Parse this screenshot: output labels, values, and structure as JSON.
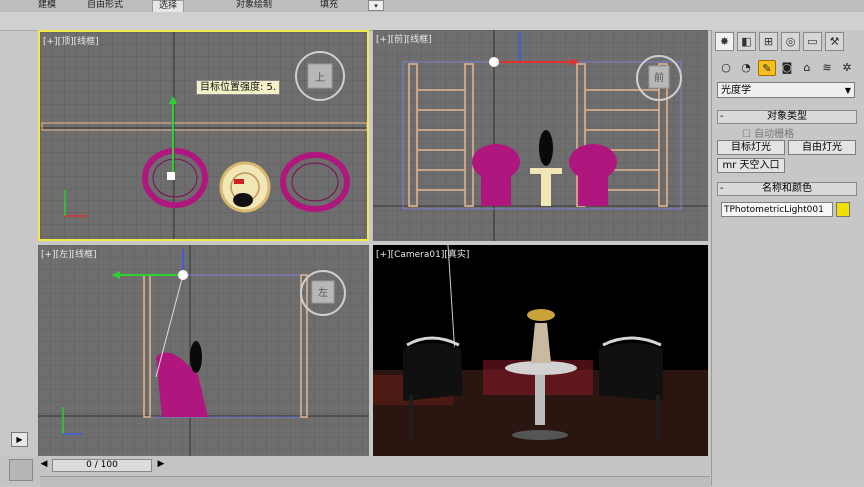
{
  "ribbon": {
    "tabs": [
      "建模",
      "自由形式",
      "选择",
      "对象绘制",
      "填充"
    ],
    "active_tab": "选择"
  },
  "viewports": {
    "top": {
      "label": "[+][顶][线框]",
      "tooltip": "目标位置强度: 5.",
      "view_cube": "上"
    },
    "front": {
      "label": "[+][前][线框]",
      "view_cube": "前"
    },
    "left": {
      "label": "[+][左][线框]",
      "view_cube": "左"
    },
    "camera": {
      "label": "[+][Camera01][真实]"
    }
  },
  "command_panel": {
    "tabs": [
      "create-icon",
      "modify-icon",
      "hierarchy-icon",
      "motion-icon",
      "display-icon",
      "utilities-icon"
    ],
    "subcategories": [
      "geometry-icon",
      "shapes-icon",
      "lights-icon",
      "cameras-icon",
      "helpers-icon",
      "spacewarps-icon",
      "systems-icon"
    ],
    "category_dropdown": "光度学",
    "object_type": {
      "header": "对象类型",
      "autogrid": "自动栅格",
      "buttons": [
        "目标灯光",
        "自由灯光",
        "mr 天空入口"
      ]
    },
    "name_color": {
      "header": "名称和颜色",
      "name": "TPhotometricLight001",
      "color": "#f0e000"
    }
  },
  "timeline": {
    "frame": "0 / 100"
  }
}
